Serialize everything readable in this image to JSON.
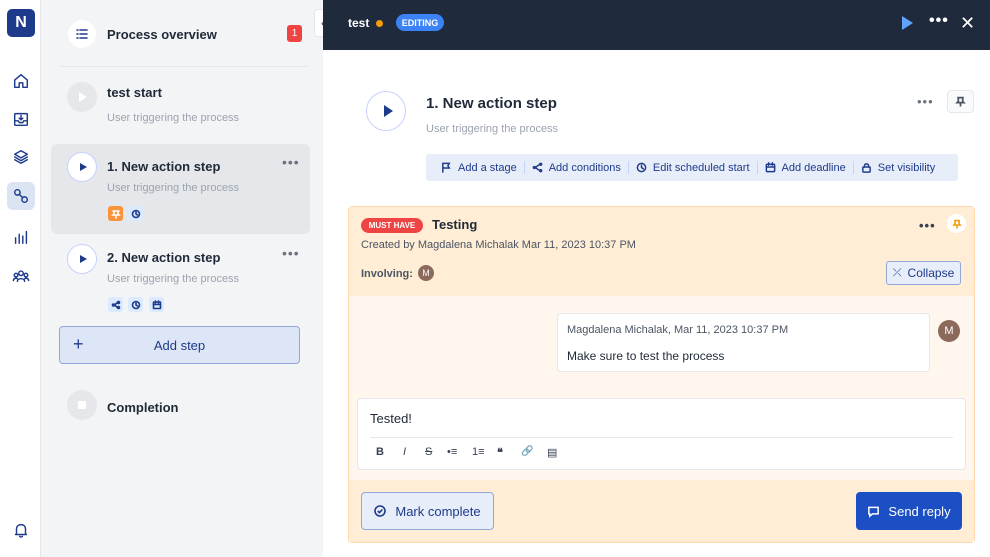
{
  "rail": {
    "logo": "N",
    "icons": [
      "home-icon",
      "inbox-icon",
      "layers-icon",
      "process-icon",
      "analytics-icon",
      "team-icon",
      "bell-icon"
    ]
  },
  "sidebar": {
    "overview_title": "Process overview",
    "overview_badge": "1",
    "steps": [
      {
        "title": "test start",
        "subtitle": "User triggering the process"
      },
      {
        "title": "1. New action step",
        "subtitle": "User triggering the process"
      },
      {
        "title": "2. New action step",
        "subtitle": "User triggering the process"
      }
    ],
    "add_step": "Add step",
    "completion": "Completion"
  },
  "topbar": {
    "title": "test",
    "mode_badge": "EDITING"
  },
  "main": {
    "title": "1. New action step",
    "subtitle": "User triggering the process",
    "actions": [
      "Add a stage",
      "Add conditions",
      "Edit scheduled start",
      "Add deadline",
      "Set visibility"
    ]
  },
  "comment": {
    "tag": "MUST HAVE",
    "title": "Testing",
    "meta": "Created by Magdalena Michalak Mar 11, 2023 10:37 PM",
    "involving_label": "Involving:",
    "involving_avatar": "M",
    "collapse": "Collapse",
    "message_meta": "Magdalena Michalak, Mar 11, 2023 10:37 PM",
    "message_text": "Make sure to test the process",
    "message_avatar": "M",
    "reply_text": "Tested!",
    "toolbar": [
      "B",
      "I",
      "S",
      "•≡",
      "1≡",
      "❝",
      "🔗",
      "▤"
    ],
    "mark_complete": "Mark complete",
    "send_reply": "Send reply"
  },
  "colors": {
    "brand": "#1e3a8a",
    "topbar": "#1f2a3c",
    "accent": "#1d4fc4",
    "must_have": "#ef4444",
    "comment_bg": "#ffedd5"
  }
}
